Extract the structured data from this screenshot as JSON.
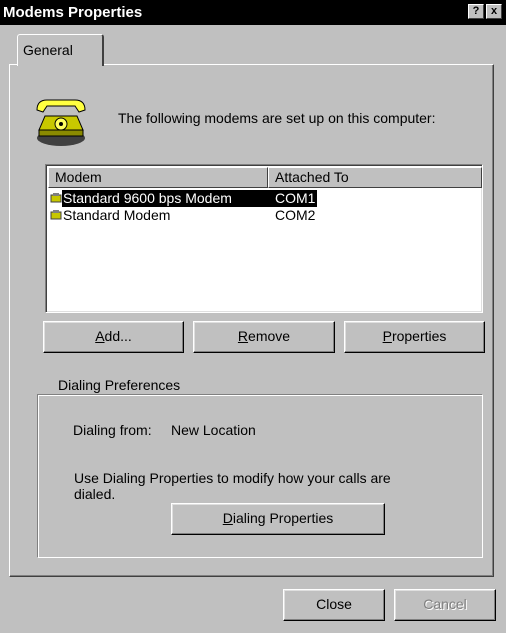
{
  "window": {
    "title": "Modems Properties",
    "help_label": "?",
    "close_label": "x"
  },
  "tabs": [
    {
      "label": "General",
      "selected": true
    }
  ],
  "intro_text": "The following modems are set up on this computer:",
  "modem_list": {
    "columns": [
      "Modem",
      "Attached To"
    ],
    "rows": [
      {
        "modem": "Standard  9600 bps Modem",
        "port": "COM1",
        "selected": true,
        "icon": "modem-icon"
      },
      {
        "modem": "Standard Modem",
        "port": "COM2",
        "selected": false,
        "icon": "modem-icon"
      }
    ]
  },
  "buttons": {
    "add": {
      "before": "",
      "mnemonic": "A",
      "after": "dd..."
    },
    "remove": {
      "before": "",
      "mnemonic": "R",
      "after": "emove"
    },
    "properties": {
      "before": "",
      "mnemonic": "P",
      "after": "roperties"
    }
  },
  "dialing": {
    "group_label": "Dialing Preferences",
    "from_label": "Dialing from:",
    "from_value": "New Location",
    "info_line1": "Use Dialing Properties to modify how your calls are",
    "info_line2": "dialed.",
    "button": {
      "before": "",
      "mnemonic": "D",
      "after": "ialing Properties"
    }
  },
  "footer": {
    "close_label": "Close",
    "cancel_label": "Cancel",
    "cancel_enabled": false
  },
  "colors": {
    "face": "#c0c0c0",
    "titlebar": "#000000",
    "selection": "#000000"
  }
}
